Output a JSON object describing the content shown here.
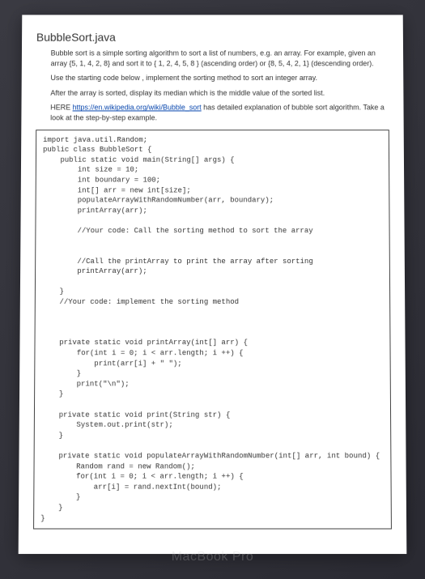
{
  "title": "BubbleSort.java",
  "paragraphs": [
    "Bubble sort is a simple sorting algorithm to sort a list of numbers, e.g. an array. For example, given an array {5, 1, 4, 2, 8} and sort it to { 1, 2, 4, 5, 8 } (ascending order) or {8, 5, 4, 2, 1} (descending order).",
    "Use the starting code below , implement the sorting method to sort an integer array.",
    "After the array is sorted, display its median which is the middle value of the sorted list."
  ],
  "link_prefix": "HERE ",
  "link_text": "https://en.wikipedia.org/wiki/Bubble_sort",
  "link_suffix": " has detailed explanation of bubble sort algorithm. Take a look at the step-by-step example.",
  "code": "import java.util.Random;\npublic class BubbleSort {\n    public static void main(String[] args) {\n        int size = 10;\n        int boundary = 100;\n        int[] arr = new int[size];\n        populateArrayWithRandomNumber(arr, boundary);\n        printArray(arr);\n\n        //Your code: Call the sorting method to sort the array\n\n\n        //Call the printArray to print the array after sorting\n        printArray(arr);\n\n    }\n    //Your code: implement the sorting method\n\n\n\n    private static void printArray(int[] arr) {\n        for(int i = 0; i < arr.length; i ++) {\n            print(arr[i] + \" \");\n        }\n        print(\"\\n\");\n    }\n\n    private static void print(String str) {\n        System.out.print(str);\n    }\n\n    private static void populateArrayWithRandomNumber(int[] arr, int bound) {\n        Random rand = new Random();\n        for(int i = 0; i < arr.length; i ++) {\n            arr[i] = rand.nextInt(bound);\n        }\n    }\n}",
  "watermark": "MacBook Pro"
}
